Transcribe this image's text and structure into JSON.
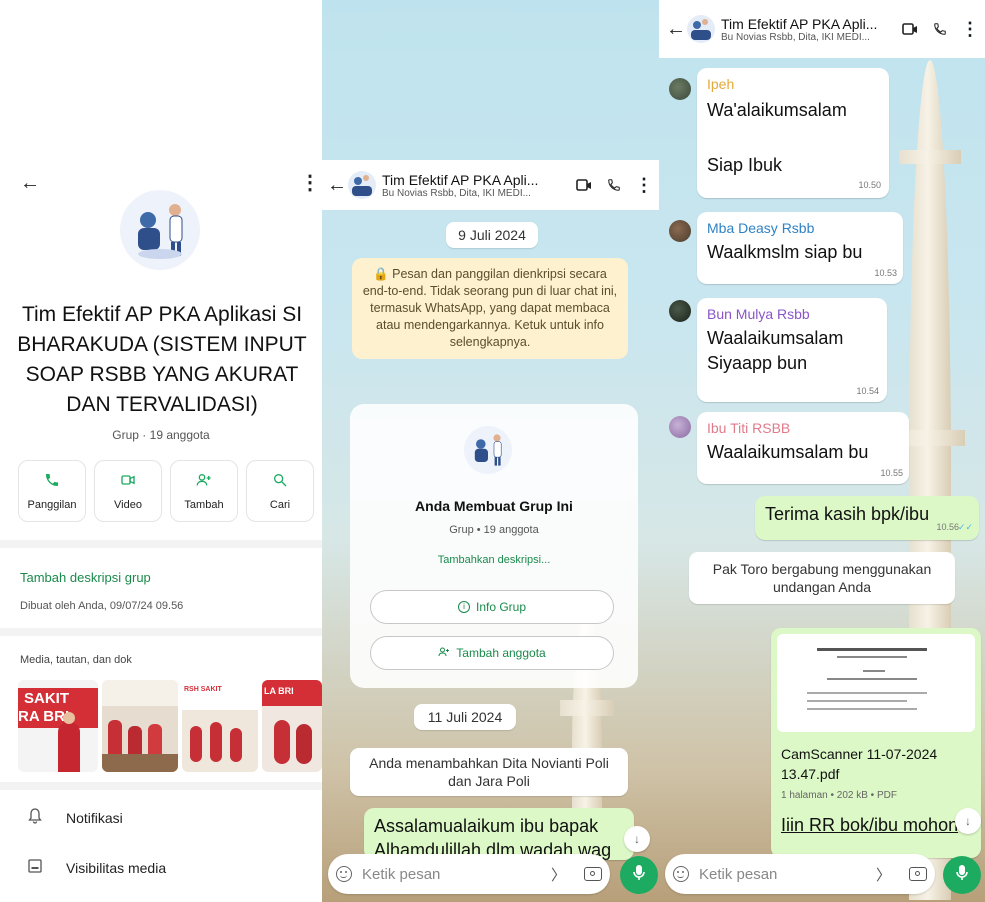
{
  "colors": {
    "accent": "#1daa61",
    "outgoing_bubble": "#dcf8c6",
    "encryption_bg": "#fdf1cf"
  },
  "panel1": {
    "back_icon": "back-arrow-icon",
    "menu_icon": "more-vertical-icon",
    "group_name": "Tim Efektif AP PKA Aplikasi SI BHARAKUDA (SISTEM INPUT SOAP RSBB YANG AKURAT DAN TERVALIDASI)",
    "group_meta": "Grup · 19 anggota",
    "actions": [
      {
        "label": "Panggilan",
        "icon": "phone-icon"
      },
      {
        "label": "Video",
        "icon": "video-icon"
      },
      {
        "label": "Tambah",
        "icon": "add-person-icon"
      },
      {
        "label": "Cari",
        "icon": "search-icon"
      }
    ],
    "add_description": "Tambah deskripsi grup",
    "created_by": "Dibuat oleh Anda, 09/07/24 09.56",
    "media_label": "Media, tautan, dan dok",
    "photo_texts": [
      "SAKIT",
      "RA BRI",
      "RSH SAKIT",
      "LA BRI"
    ],
    "menu": [
      {
        "label": "Notifikasi",
        "icon": "bell-icon"
      },
      {
        "label": "Visibilitas media",
        "icon": "media-visibility-icon"
      }
    ]
  },
  "panel2": {
    "header": {
      "title": "Tim Efektif AP PKA Apli...",
      "subtitle": "Bu Novias Rsbb, Dita, IKI MEDI..."
    },
    "date1": "9 Juli 2024",
    "encryption_notice": "🔒 Pesan dan panggilan dienkripsi secara end-to-end. Tidak seorang pun di luar chat ini, termasuk WhatsApp, yang dapat membaca atau mendengarkannya. Ketuk untuk info selengkapnya.",
    "card": {
      "title": "Anda Membuat Grup Ini",
      "meta": "Grup • 19 anggota",
      "add_desc": "Tambahkan deskripsi...",
      "info_btn": "Info Grup",
      "add_member_btn": "Tambah anggota"
    },
    "date2": "11 Juli 2024",
    "system_msg": "Anda menambahkan Dita Novianti Poli dan Jara Poli",
    "outgoing_msg": "Assalamualaikum ibu bapak Alhamdulillah dlm wadah wag",
    "composer_placeholder": "Ketik pesan"
  },
  "panel3": {
    "header": {
      "title": "Tim Efektif AP PKA Apli...",
      "subtitle": "Bu Novias Rsbb, Dita, IKI MEDI..."
    },
    "messages": [
      {
        "sender": "Ipeh",
        "color": "#e5a93a",
        "line1": "Wa'alaikumsalam",
        "line2": "Siap Ibuk",
        "time": "10.50"
      },
      {
        "sender": "Mba Deasy Rsbb",
        "color": "#2f82c4",
        "line1": "Waalkmslm siap bu",
        "time": "10.53"
      },
      {
        "sender": "Bun Mulya Rsbb",
        "color": "#8a55c8",
        "line1": "Waalaikumsalam",
        "line2": "Siyaapp bun",
        "time": "10.54"
      },
      {
        "sender": "Ibu Titi RSBB",
        "color": "#e07b8a",
        "line1": "Waalaikumsalam bu",
        "time": "10.55"
      }
    ],
    "outgoing": {
      "text": "Terima kasih bpk/ibu",
      "time": "10.56"
    },
    "system_msg": "Pak Toro bergabung menggunakan undangan Anda",
    "document": {
      "name": "CamScanner 11-07-2024 13.47.pdf",
      "meta": "1 halaman • 202 kB • PDF"
    },
    "partial_msg": "Iiin RR bok/ibu mohon",
    "composer_placeholder": "Ketik pesan"
  }
}
